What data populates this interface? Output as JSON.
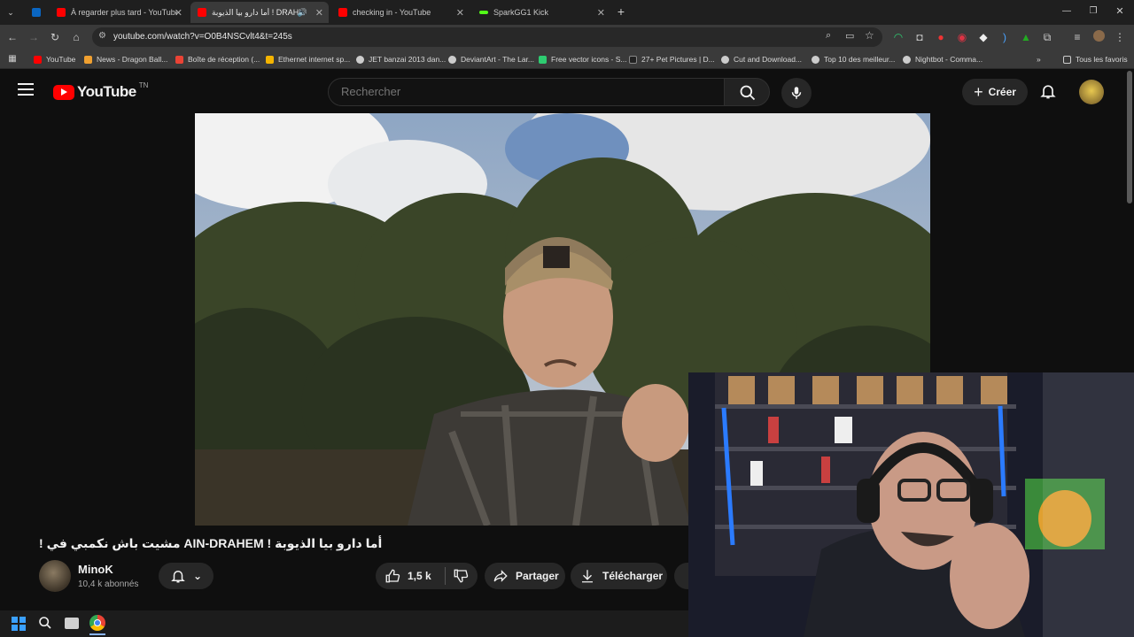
{
  "browser": {
    "tabs": [
      {
        "label": "",
        "favicon_color": "#0a66c2"
      },
      {
        "label": "À regarder plus tard - YouTube",
        "favicon_color": "#ff0000"
      },
      {
        "label": "أما دارو بيا الذيوبة ! DRAHEM",
        "favicon_color": "#ff0000"
      },
      {
        "label": "checking in - YouTube",
        "favicon_color": "#ff0000"
      },
      {
        "label": "SparkGG1 Kick",
        "favicon_color": "#53fc18"
      }
    ],
    "url": "youtube.com/watch?v=O0B4NSCvlt4&t=245s",
    "bookmarks": [
      {
        "label": "YouTube",
        "color": "#ff0000"
      },
      {
        "label": "News - Dragon Ball...",
        "color": "#f0a030"
      },
      {
        "label": "Boîte de réception (...",
        "color": "#ea4335"
      },
      {
        "label": "Ethernet internet sp...",
        "color": "#f4b400"
      },
      {
        "label": "JET banzai 2013 dan...",
        "color": "#cccccc"
      },
      {
        "label": "DeviantArt - The Lar...",
        "color": "#cccccc"
      },
      {
        "label": "Free vector icons - S...",
        "color": "#2ecc71"
      },
      {
        "label": "27+ Pet Pictures | D...",
        "color": "#222222"
      },
      {
        "label": "Cut and Download...",
        "color": "#cccccc"
      },
      {
        "label": "Top 10 des meilleur...",
        "color": "#cccccc"
      },
      {
        "label": "Nightbot - Comma...",
        "color": "#cccccc"
      }
    ],
    "all_bookmarks_label": "Tous les favoris"
  },
  "youtube": {
    "logo_text": "YouTube",
    "country_code": "TN",
    "search_placeholder": "Rechercher",
    "create_label": "Créer",
    "video_title": "! مشيت باش نكمبي في AIN-DRAHEM ! أما دارو بيا الذيوبة",
    "channel_name": "MinoK",
    "subscribers": "10,4 k abonnés",
    "likes": "1,5 k",
    "share_label": "Partager",
    "download_label": "Télécharger"
  },
  "colors": {
    "yt_red": "#ff0000",
    "background": "#0f0f0f",
    "pill_bg": "#272727"
  }
}
